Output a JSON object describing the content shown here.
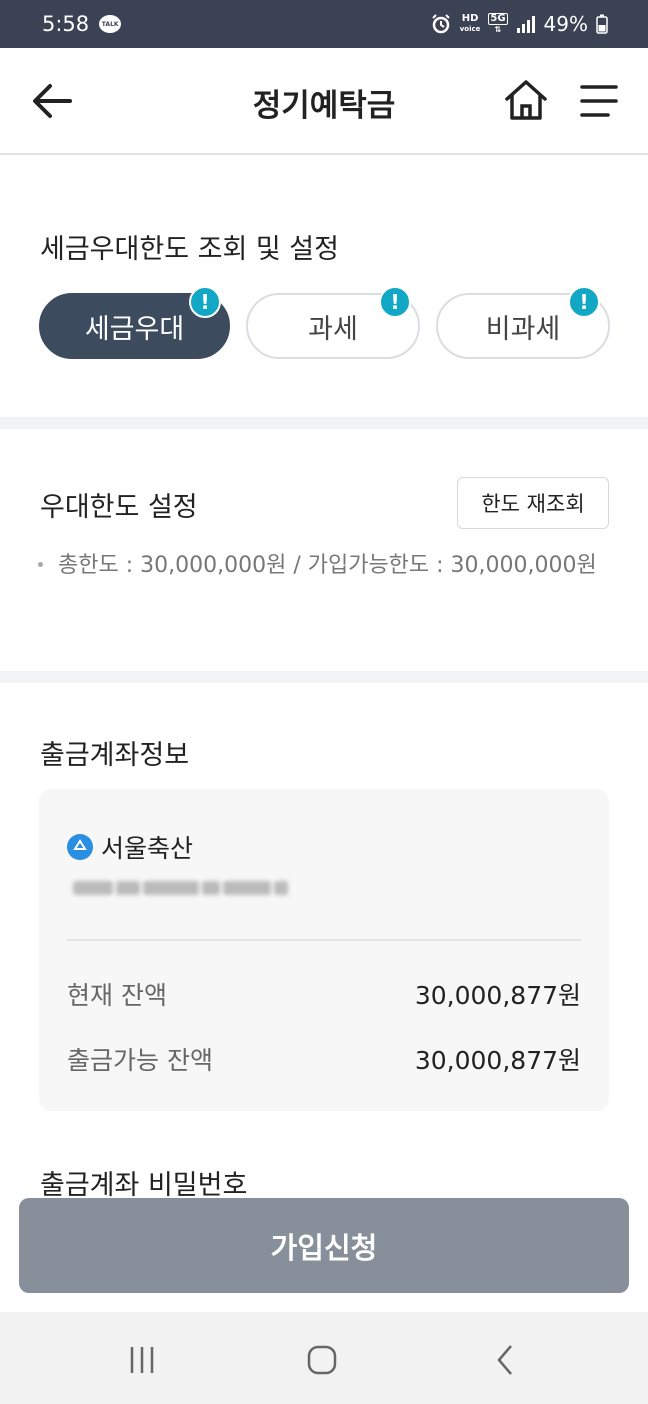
{
  "status_bar": {
    "time": "5:58",
    "talk_label": "TALK",
    "hd_top": "HD",
    "hd_bottom": "voice",
    "network": "5G",
    "battery": "49%"
  },
  "header": {
    "title": "정기예탁금"
  },
  "tax_section": {
    "title": "세금우대한도 조회 및 설정",
    "options": [
      {
        "label": "세금우대",
        "selected": true
      },
      {
        "label": "과세",
        "selected": false
      },
      {
        "label": "비과세",
        "selected": false
      }
    ],
    "badge": "!"
  },
  "limit_section": {
    "title": "우대한도 설정",
    "requery_label": "한도 재조회",
    "limit_text": "총한도 : 30,000,000원 / 가입가능한도 : 30,000,000원"
  },
  "account_section": {
    "title": "출금계좌정보",
    "bank_name": "서울축산",
    "balance_label": "현재 잔액",
    "balance_value": "30,000,877원",
    "available_label": "출금가능 잔액",
    "available_value": "30,000,877원"
  },
  "password_section": {
    "title": "출금계좌 비밀번호"
  },
  "submit": {
    "label": "가입신청"
  },
  "colors": {
    "status_bar": "#3b4254",
    "active_pill": "#3d4b5e",
    "badge": "#12a7c4",
    "submit": "#878f9a"
  }
}
